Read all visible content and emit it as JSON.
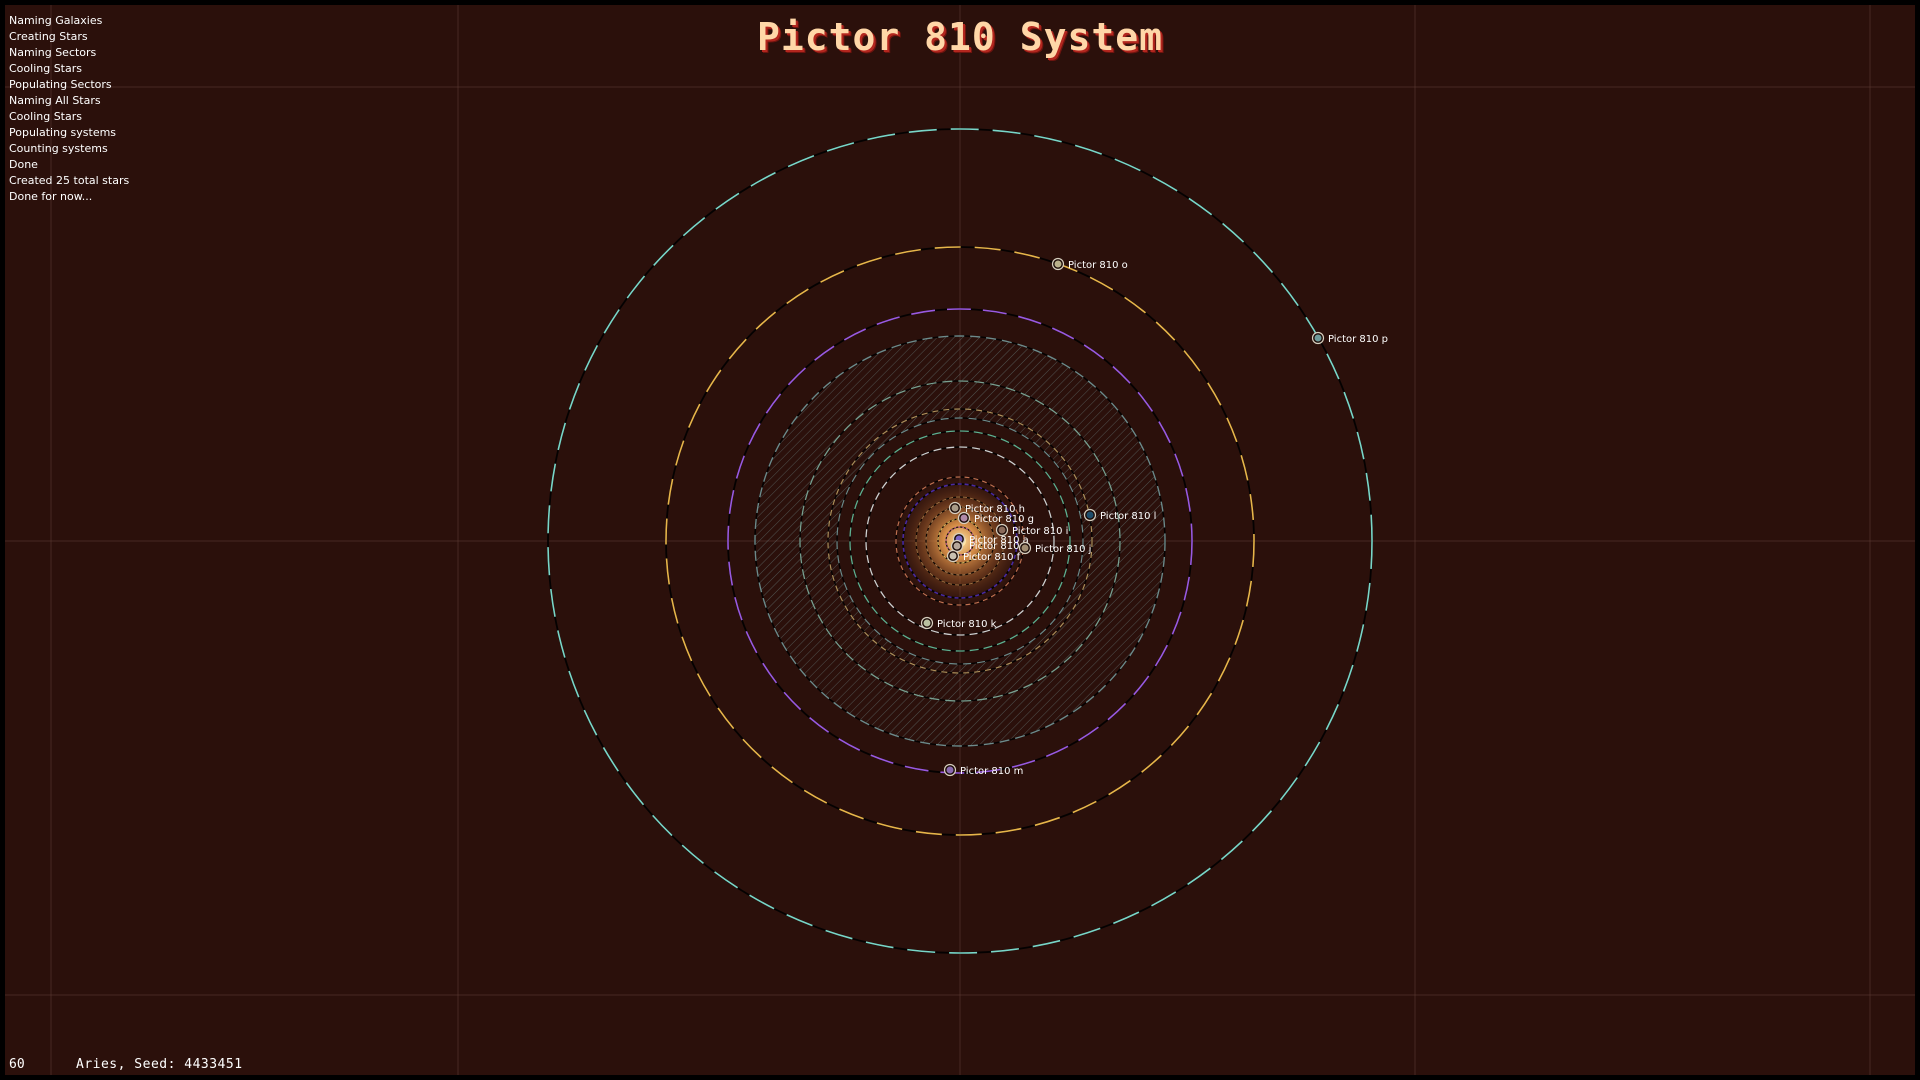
{
  "title": "Pictor 810 System",
  "log": [
    "Naming Galaxies",
    "Creating Stars",
    "Naming Sectors",
    "Cooling Stars",
    "Populating Sectors",
    "Naming All Stars",
    "Cooling Stars",
    "Populating systems",
    "Counting systems",
    "Done",
    "Created 25 total stars",
    "Done for now..."
  ],
  "footer": {
    "fps": "60",
    "seed_line": "Aries, Seed: 4433451"
  },
  "planets": [
    {
      "name": "Pictor 810 o",
      "color": "#b9b08a"
    },
    {
      "name": "Pictor 810 p",
      "color": "#6f9a9a"
    },
    {
      "name": "Pictor 810 h",
      "color": "#a89a86"
    },
    {
      "name": "Pictor 810 g",
      "color": "#b08aa8"
    },
    {
      "name": "Pictor 810 i",
      "color": "#8a6a5a"
    },
    {
      "name": "Pictor 810 l",
      "color": "#1e4d6b"
    },
    {
      "name": "Pictor 810 a",
      "color": "#7a66c8"
    },
    {
      "name": "Pictor 810 e",
      "color": "#b7a79a"
    },
    {
      "name": "Pictor 810 j",
      "color": "#a08c70"
    },
    {
      "name": "Pictor 810 f",
      "color": "#c8c0b0"
    },
    {
      "name": "Pictor 810 k",
      "color": "#b9c0a0"
    },
    {
      "name": "Pictor 810 m",
      "color": "#8a6ab0"
    }
  ],
  "colors": {
    "background": "#2b100b",
    "grid": "#5a3a33",
    "orbit_cyan": "#7ad6c8",
    "orbit_gold": "#e8b54a",
    "orbit_purple": "#9a5ae0",
    "belt": "#6e8a8a"
  }
}
